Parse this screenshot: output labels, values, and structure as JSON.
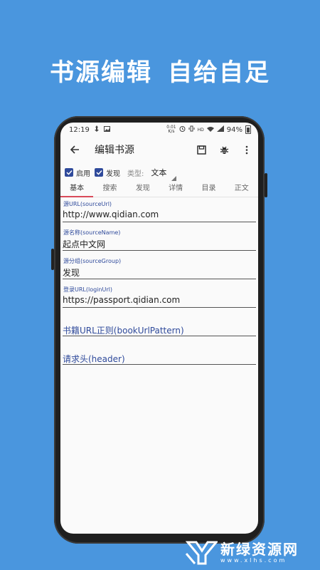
{
  "headline": {
    "part1": "书源编辑",
    "part2": "自给自足"
  },
  "statusbar": {
    "time": "12:19",
    "net_speed_top": "0.01",
    "net_speed_bottom": "K/s",
    "hd": "HD",
    "battery": "94%"
  },
  "toolbar": {
    "title": "编辑书源",
    "back_icon": "arrow-left-icon",
    "save_icon": "save-icon",
    "debug_icon": "bug-icon",
    "more_icon": "more-vert-icon"
  },
  "options": {
    "enable_label": "启用",
    "discover_label": "发现",
    "type_label": "类型:",
    "type_value": "文本"
  },
  "tabs": [
    "基本",
    "搜索",
    "发现",
    "详情",
    "目录",
    "正文"
  ],
  "fields": [
    {
      "label": "源URL(sourceUrl)",
      "value": "http://www.qidian.com"
    },
    {
      "label": "源名称(sourceName)",
      "value": "起点中文网"
    },
    {
      "label": "源分组(sourceGroup)",
      "value": "发现"
    },
    {
      "label": "登录URL(loginUrl)",
      "value": "https://passport.qidian.com"
    }
  ],
  "hint_fields": [
    {
      "hint": "书籍URL正则(bookUrlPattern)"
    },
    {
      "hint": "请求头(header)"
    }
  ],
  "watermark": {
    "main": "新绿资源网",
    "sub": "www.xlhs.com"
  },
  "colors": {
    "background": "#4a96de",
    "accent": "#2f4a9b",
    "tab_indicator": "#d94a5a"
  }
}
